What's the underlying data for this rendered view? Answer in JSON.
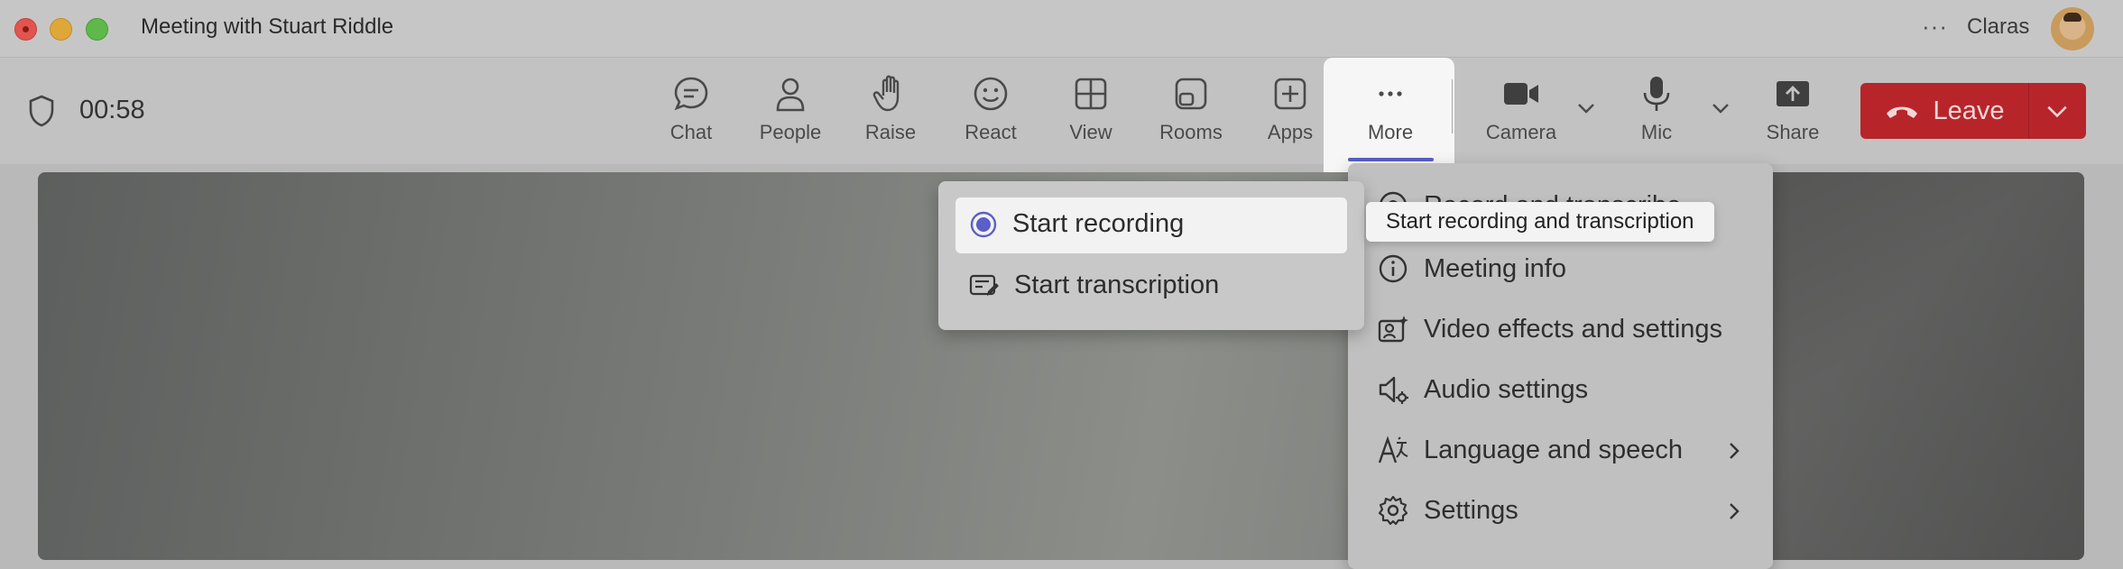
{
  "window": {
    "title": "Meeting with Stuart Riddle",
    "more_glyph": "···",
    "user_name": "Claras"
  },
  "toolbar": {
    "timer": "00:58",
    "buttons": [
      {
        "label": "Chat",
        "icon": "chat-icon"
      },
      {
        "label": "People",
        "icon": "people-icon"
      },
      {
        "label": "Raise",
        "icon": "hand-icon"
      },
      {
        "label": "React",
        "icon": "smile-icon"
      },
      {
        "label": "View",
        "icon": "grid-icon"
      },
      {
        "label": "Rooms",
        "icon": "rooms-icon"
      },
      {
        "label": "Apps",
        "icon": "plus-icon"
      },
      {
        "label": "More",
        "icon": "more-icon"
      },
      {
        "label": "Camera",
        "icon": "camera-icon"
      },
      {
        "label": "Mic",
        "icon": "mic-icon"
      },
      {
        "label": "Share",
        "icon": "share-icon"
      }
    ],
    "leave_label": "Leave",
    "accent_color": "#5b5fc7",
    "leave_color": "#b7252a"
  },
  "more_menu": {
    "items": [
      {
        "label": "Record and transcribe",
        "icon": "record-icon"
      },
      {
        "label": "Meeting info",
        "icon": "info-icon"
      },
      {
        "label": "Video effects and settings",
        "icon": "video-effects-icon"
      },
      {
        "label": "Audio settings",
        "icon": "audio-settings-icon"
      },
      {
        "label": "Language and speech",
        "icon": "language-icon"
      },
      {
        "label": "Settings",
        "icon": "gear-icon"
      }
    ]
  },
  "record_submenu": {
    "items": [
      {
        "label": "Start recording",
        "icon": "record-dot-icon"
      },
      {
        "label": "Start transcription",
        "icon": "transcription-icon"
      }
    ]
  },
  "tooltip": "Start recording and transcription"
}
